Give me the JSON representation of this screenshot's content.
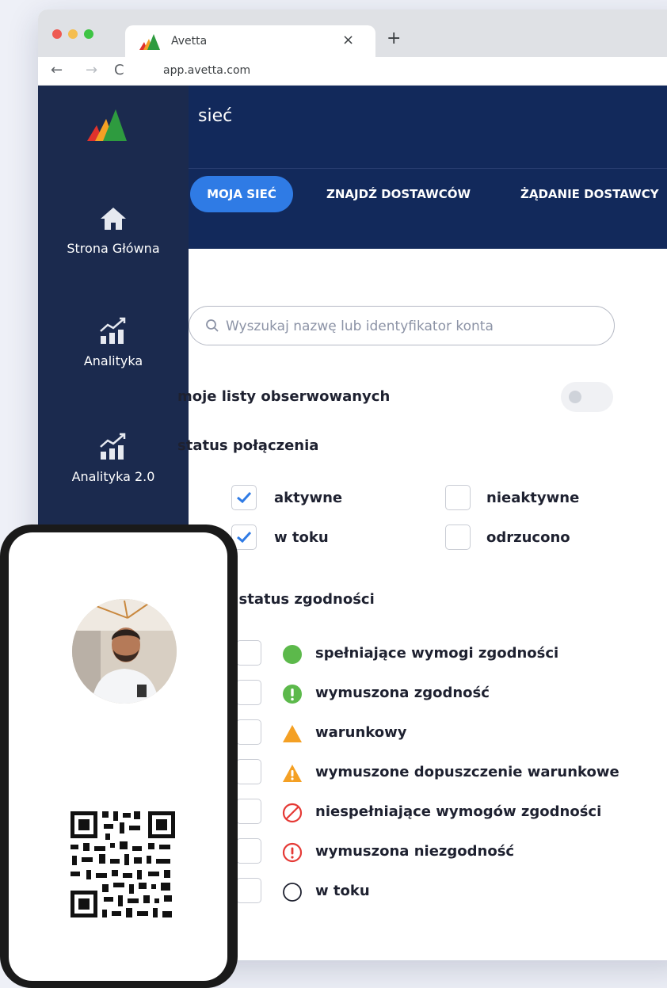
{
  "browser": {
    "tab_title": "Avetta",
    "close_glyph": "×",
    "new_tab_glyph": "+",
    "url": "app.avetta.com",
    "back_glyph": "←",
    "forward_glyph": "→",
    "reload_glyph": "C"
  },
  "sidebar": {
    "items": [
      {
        "label": "Strona Główna",
        "icon": "home-icon"
      },
      {
        "label": "Analityka",
        "icon": "analytics-icon"
      },
      {
        "label": "Analityka 2.0",
        "icon": "analytics-icon"
      }
    ]
  },
  "header": {
    "title": "sieć",
    "tabs": [
      {
        "label": "MOJA SIEĆ",
        "active": true
      },
      {
        "label": "ZNAJDŹ DOSTAWCÓW",
        "active": false
      },
      {
        "label": "ŻĄDANIE DOSTAWCY",
        "active": false
      }
    ]
  },
  "filters": {
    "search_placeholder": "Wyszukaj nazwę lub identyfikator konta",
    "watchlists_label": "moje listy obserwowanych",
    "watchlists_on": false,
    "connection_status_label": "status połączenia",
    "connection_status": [
      {
        "label": "aktywne",
        "checked": true
      },
      {
        "label": "nieaktywne",
        "checked": false
      },
      {
        "label": "w toku",
        "checked": true
      },
      {
        "label": "odrzucono",
        "checked": false
      }
    ],
    "compliance_label": "Ogólny status zgodności",
    "compliance": [
      {
        "label": "spełniające wymogi zgodności",
        "icon": "green-circle-icon",
        "color": "#5cb94b",
        "checked": false
      },
      {
        "label": "wymuszona zgodność",
        "icon": "green-exclamation-icon",
        "color": "#5cb94b",
        "checked": false
      },
      {
        "label": "warunkowy",
        "icon": "orange-triangle-icon",
        "color": "#f4a024",
        "checked": false
      },
      {
        "label": "wymuszone dopuszczenie warunkowe",
        "icon": "orange-warning-triangle-icon",
        "color": "#f4a024",
        "checked": false
      },
      {
        "label": "niespełniające wymogów zgodności",
        "icon": "red-prohibited-icon",
        "color": "#e53935",
        "checked": false
      },
      {
        "label": "wymuszona niezgodność",
        "icon": "red-exclamation-circle-icon",
        "color": "#e53935",
        "checked": false
      },
      {
        "label": "w toku",
        "icon": "empty-circle-icon",
        "color": "#1e2130",
        "checked": false
      }
    ]
  },
  "colors": {
    "navy": "#12295b",
    "sidebar": "#1b2a4e",
    "accent": "#2f7be5"
  }
}
